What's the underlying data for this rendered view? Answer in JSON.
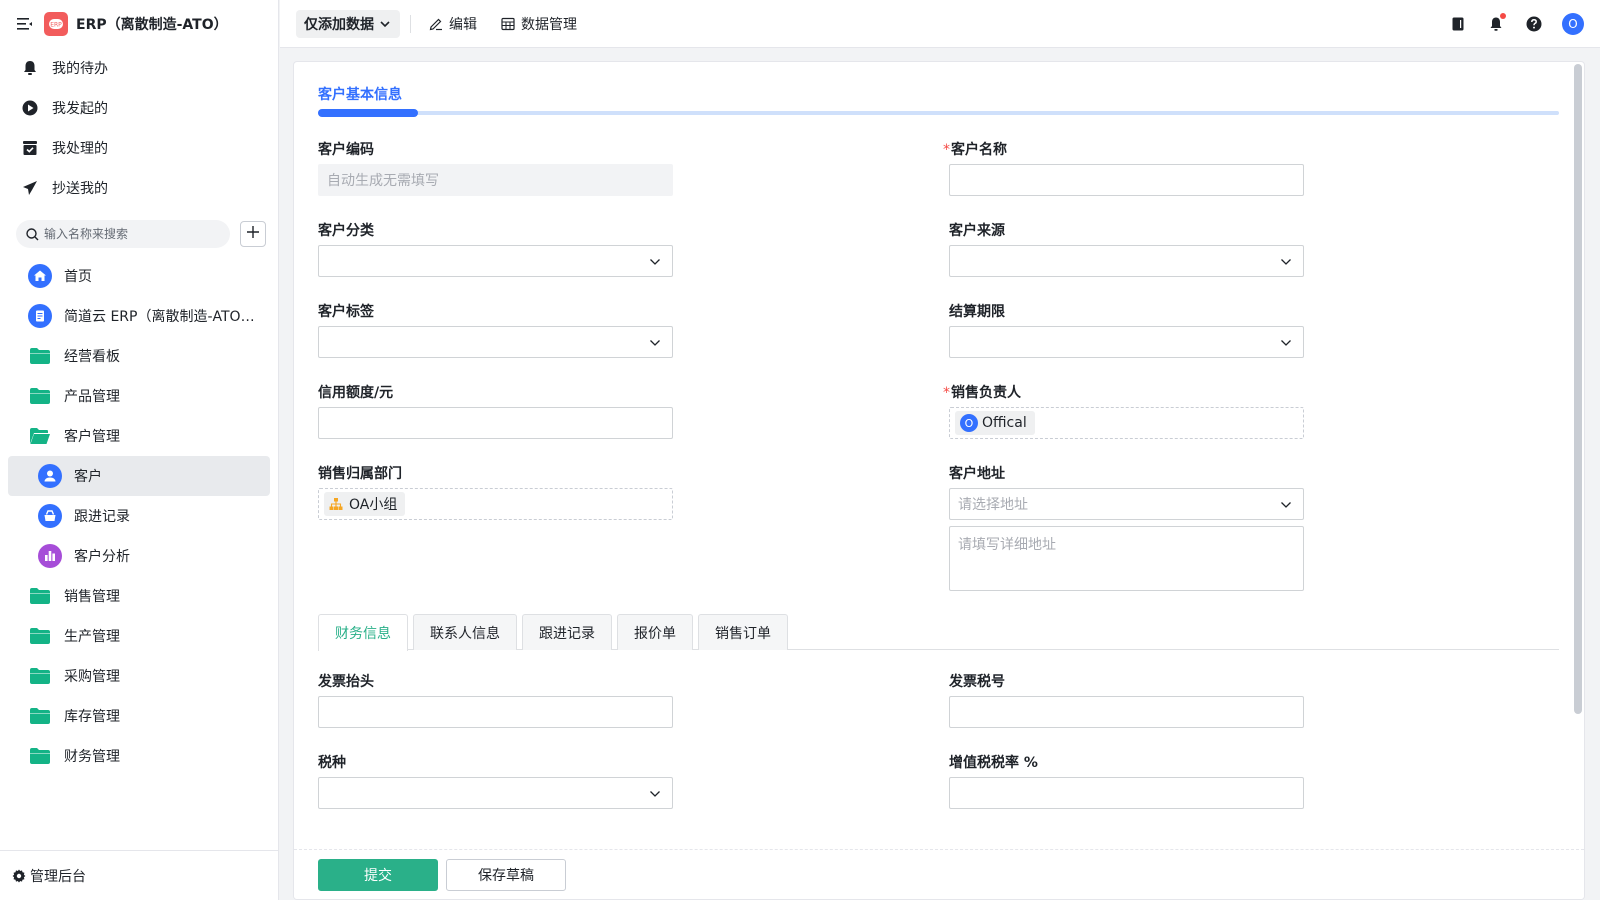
{
  "app": {
    "title": "ERP（离散制造-ATO）",
    "logo_icon": "app-logo-icon",
    "brand_color": "#f25c5c"
  },
  "sidebar": {
    "quick": [
      {
        "label": "我的待办",
        "icon": "bell-icon"
      },
      {
        "label": "我发起的",
        "icon": "play-circle-icon"
      },
      {
        "label": "我处理的",
        "icon": "check-box-icon"
      },
      {
        "label": "抄送我的",
        "icon": "send-icon"
      }
    ],
    "search_placeholder": "输入名称来搜索",
    "nav": [
      {
        "label": "首页",
        "icon": "home-icon"
      },
      {
        "label": "简道云 ERP（离散制造-ATO）...",
        "icon": "document-icon"
      },
      {
        "label": "经营看板",
        "icon": "folder-icon"
      },
      {
        "label": "产品管理",
        "icon": "folder-icon"
      },
      {
        "label": "客户管理",
        "icon": "folder-open-icon"
      },
      {
        "label": "客户",
        "icon": "customer-icon",
        "active": true
      },
      {
        "label": "跟进记录",
        "icon": "followup-icon"
      },
      {
        "label": "客户分析",
        "icon": "chart-icon"
      },
      {
        "label": "销售管理",
        "icon": "folder-icon"
      },
      {
        "label": "生产管理",
        "icon": "folder-icon"
      },
      {
        "label": "采购管理",
        "icon": "folder-icon"
      },
      {
        "label": "库存管理",
        "icon": "folder-icon"
      },
      {
        "label": "财务管理",
        "icon": "folder-icon"
      }
    ],
    "footer_label": "管理后台"
  },
  "topbar": {
    "mode_label": "仅添加数据",
    "edit_label": "编辑",
    "data_manage_label": "数据管理",
    "avatar_letter": "O"
  },
  "form": {
    "section_title": "客户基本信息",
    "customer_code": {
      "label": "客户编码",
      "placeholder": "自动生成无需填写"
    },
    "customer_name": {
      "label": "客户名称",
      "required": "*"
    },
    "customer_category": {
      "label": "客户分类"
    },
    "customer_source": {
      "label": "客户来源"
    },
    "customer_tags": {
      "label": "客户标签"
    },
    "settlement_period": {
      "label": "结算期限"
    },
    "credit_limit": {
      "label": "信用额度/元"
    },
    "sales_owner": {
      "label": "销售负责人",
      "required": "*",
      "value": "Offical",
      "avatar_letter": "O"
    },
    "sales_dept": {
      "label": "销售归属部门",
      "value": "OA小组"
    },
    "customer_address": {
      "label": "客户地址",
      "select_placeholder": "请选择地址",
      "detail_placeholder": "请填写详细地址"
    }
  },
  "subtabs": [
    {
      "label": "财务信息",
      "active": true
    },
    {
      "label": "联系人信息"
    },
    {
      "label": "跟进记录"
    },
    {
      "label": "报价单"
    },
    {
      "label": "销售订单"
    }
  ],
  "finance": {
    "invoice_title": {
      "label": "发票抬头"
    },
    "tax_number": {
      "label": "发票税号"
    },
    "tax_type": {
      "label": "税种"
    },
    "vat_rate": {
      "label": "增值税税率 %"
    }
  },
  "footer": {
    "submit_label": "提交",
    "draft_label": "保存草稿"
  },
  "colors": {
    "accent_blue": "#3370ff",
    "accent_green": "#2ab089",
    "folder_green": "#14b386"
  }
}
